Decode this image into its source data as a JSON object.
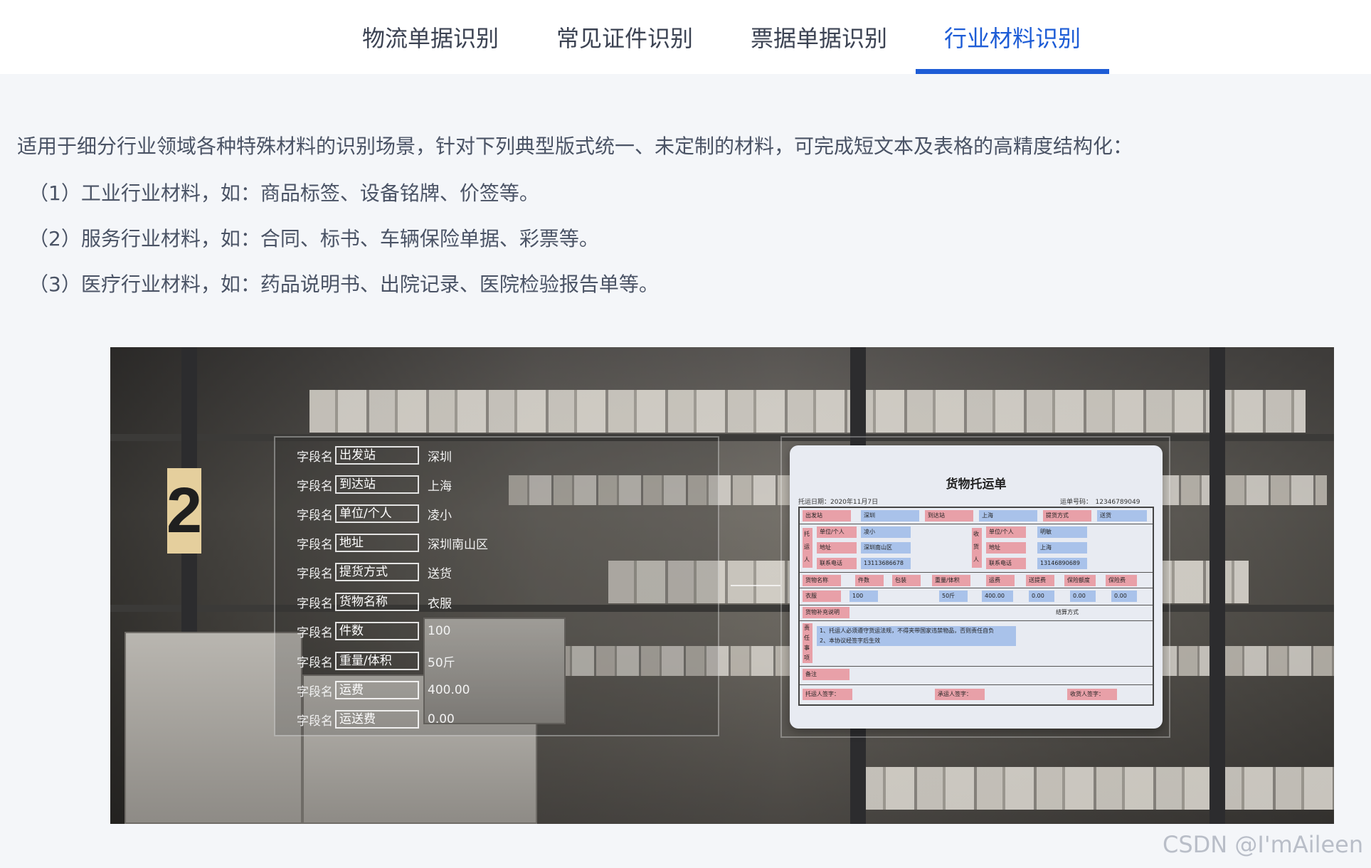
{
  "tabs": [
    {
      "label": "物流单据识别",
      "active": false
    },
    {
      "label": "常见证件识别",
      "active": false
    },
    {
      "label": "票据单据识别",
      "active": false
    },
    {
      "label": "行业材料识别",
      "active": true
    }
  ],
  "intro": "适用于细分行业领域各种特殊材料的识别场景，针对下列典型版式统一、未定制的材料，可完成短文本及表格的高精度结构化：",
  "items": [
    "（1）工业行业材料，如：商品标签、设备铭牌、价签等。",
    "（2）服务行业材料，如：合同、标书、车辆保险单据、彩票等。",
    "（3）医疗行业材料，如：药品说明书、出院记录、医院检验报告单等。"
  ],
  "hero": {
    "shelf_sign": "2",
    "field_prefix": "字段名",
    "fields": [
      {
        "name": "出发站",
        "value": "深圳"
      },
      {
        "name": "到达站",
        "value": "上海"
      },
      {
        "name": "单位/个人",
        "value": "凌小"
      },
      {
        "name": "地址",
        "value": "深圳南山区"
      },
      {
        "name": "提货方式",
        "value": "送货"
      },
      {
        "name": "货物名称",
        "value": "衣服"
      },
      {
        "name": "件数",
        "value": "100"
      },
      {
        "name": "重量/体积",
        "value": "50斤"
      },
      {
        "name": "运费",
        "value": "400.00"
      },
      {
        "name": "运送费",
        "value": "0.00"
      }
    ],
    "doc": {
      "title": "货物托运单",
      "date": "托运日期：2020年11月7日",
      "number": "运单号码：　12346789049",
      "row1": [
        "出发站",
        "深圳",
        "到达站",
        "上海",
        "提货方式",
        "送货"
      ],
      "shipper_label": "托运人",
      "receiver_label": "收货人",
      "shipper": [
        [
          "单位/个人",
          "凌小"
        ],
        [
          "地址",
          "深圳南山区"
        ],
        [
          "联系电话",
          "13113686678"
        ]
      ],
      "receiver": [
        [
          "单位/个人",
          "明敏"
        ],
        [
          "地址",
          "上海"
        ],
        [
          "联系电话",
          "13146890689"
        ]
      ],
      "goods_headers": [
        "货物名称",
        "件数",
        "包装",
        "重量/体积",
        "运费",
        "送提费",
        "保险额度",
        "保险费"
      ],
      "goods_values": [
        "衣服",
        "100",
        "",
        "50斤",
        "400.00",
        "0.00",
        "0.00",
        "0.00"
      ],
      "extra_label": "货物补充说明",
      "settle_label": "结算方式",
      "terms_label": "责任事项",
      "terms": [
        "1、托运人必须遵守货运法规，不得夹带国家违禁物品，否则责任自负",
        "2、本协议经签字后生效"
      ],
      "remark_label": "备注",
      "signs": [
        "托运人签字：",
        "承运人签字：",
        "收货人签字："
      ]
    }
  },
  "watermark": "CSDN @I'mAileen"
}
